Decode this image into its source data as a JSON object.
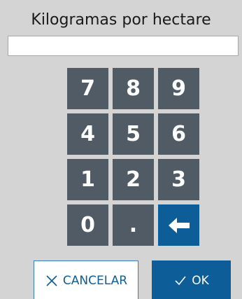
{
  "dialog": {
    "title": "Kilogramas por hectare",
    "input": {
      "value": "",
      "placeholder": ""
    }
  },
  "keypad": {
    "keys": [
      "7",
      "8",
      "9",
      "4",
      "5",
      "6",
      "1",
      "2",
      "3",
      "0",
      ".",
      "←"
    ],
    "backspace_icon": "arrow-left-icon",
    "key_color": "#515b66",
    "accent_color": "#0d5d99"
  },
  "actions": {
    "cancel_label": "CANCELAR",
    "cancel_icon": "close-icon",
    "ok_label": "OK",
    "ok_icon": "check-icon"
  }
}
